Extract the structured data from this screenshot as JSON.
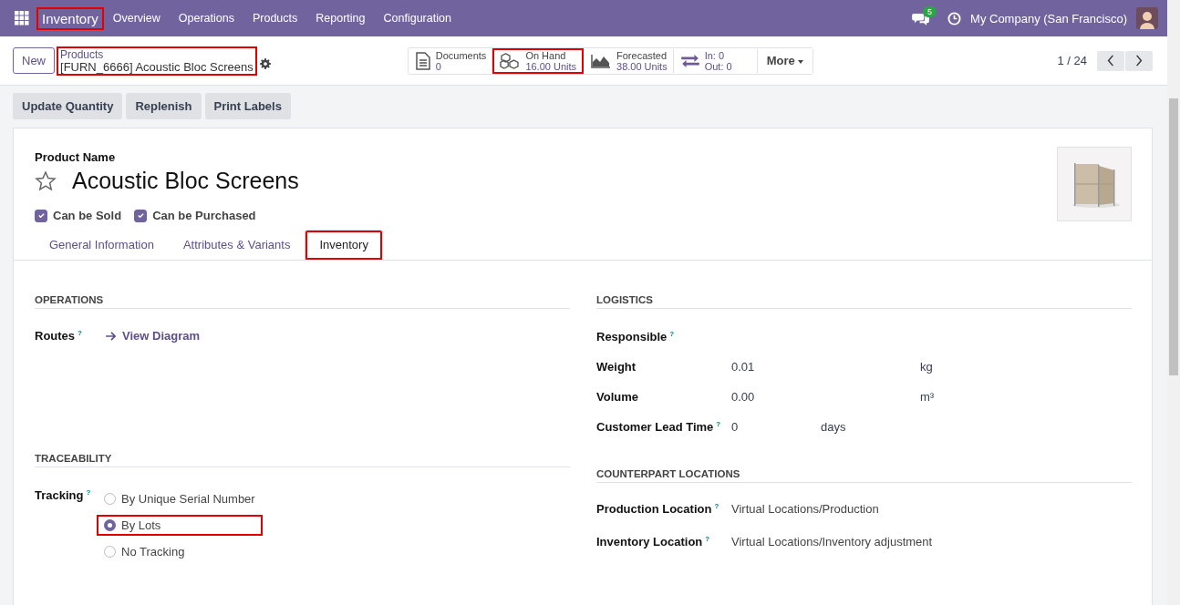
{
  "navbar": {
    "app_name": "Inventory",
    "app_highlighted": true,
    "menu": [
      "Overview",
      "Operations",
      "Products",
      "Reporting",
      "Configuration"
    ],
    "messages_badge": "5",
    "company": "My Company (San Francisco)"
  },
  "control_panel": {
    "new_button": "New",
    "breadcrumb_parent": "Products",
    "breadcrumb_current": "[FURN_6666] Acoustic Bloc Screens",
    "breadcrumb_highlighted": true,
    "smart_buttons": [
      {
        "kind": "doc",
        "label": "Documents",
        "value": "0",
        "highlighted": false
      },
      {
        "kind": "stock",
        "label": "On Hand",
        "value": "16.00 Units",
        "highlighted": true
      },
      {
        "kind": "forecast",
        "label": "Forecasted",
        "value": "38.00 Units",
        "highlighted": false
      },
      {
        "kind": "moves",
        "label": "In: 0",
        "value": "Out: 0",
        "highlighted": false
      }
    ],
    "more_button": "More",
    "pager": "1 / 24"
  },
  "actions": [
    "Update Quantity",
    "Replenish",
    "Print Labels"
  ],
  "product": {
    "name_label": "Product Name",
    "name": "Acoustic Bloc Screens",
    "favorite": false,
    "checkboxes": [
      {
        "label": "Can be Sold",
        "checked": true
      },
      {
        "label": "Can be Purchased",
        "checked": true
      }
    ]
  },
  "tabs": [
    {
      "label": "General Information",
      "selected": false,
      "highlighted": false
    },
    {
      "label": "Attributes & Variants",
      "selected": false,
      "highlighted": false
    },
    {
      "label": "Inventory",
      "selected": true,
      "highlighted": true
    }
  ],
  "operations": {
    "title": "OPERATIONS",
    "routes_label": "Routes",
    "routes_help": "?",
    "routes_link": "View Diagram"
  },
  "traceability": {
    "title": "TRACEABILITY",
    "label": "Tracking",
    "help": "?",
    "options": [
      {
        "label": "By Unique Serial Number",
        "selected": false,
        "highlighted": false
      },
      {
        "label": "By Lots",
        "selected": true,
        "highlighted": true
      },
      {
        "label": "No Tracking",
        "selected": false,
        "highlighted": false
      }
    ]
  },
  "logistics": {
    "title": "LOGISTICS",
    "rows": [
      {
        "label": "Responsible",
        "help": "?"
      },
      {
        "label": "Weight",
        "value": "0.01",
        "unit": "kg"
      },
      {
        "label": "Volume",
        "value": "0.00",
        "unit": "m³"
      },
      {
        "label": "Customer Lead Time",
        "help": "?",
        "value": "0",
        "unit": "days"
      }
    ]
  },
  "counterpart_locations": {
    "title": "COUNTERPART LOCATIONS",
    "rows": [
      {
        "label": "Production Location",
        "help": "?",
        "value": "Virtual Locations/Production"
      },
      {
        "label": "Inventory Location",
        "help": "?",
        "value": "Virtual Locations/Inventory adjustment"
      }
    ]
  }
}
